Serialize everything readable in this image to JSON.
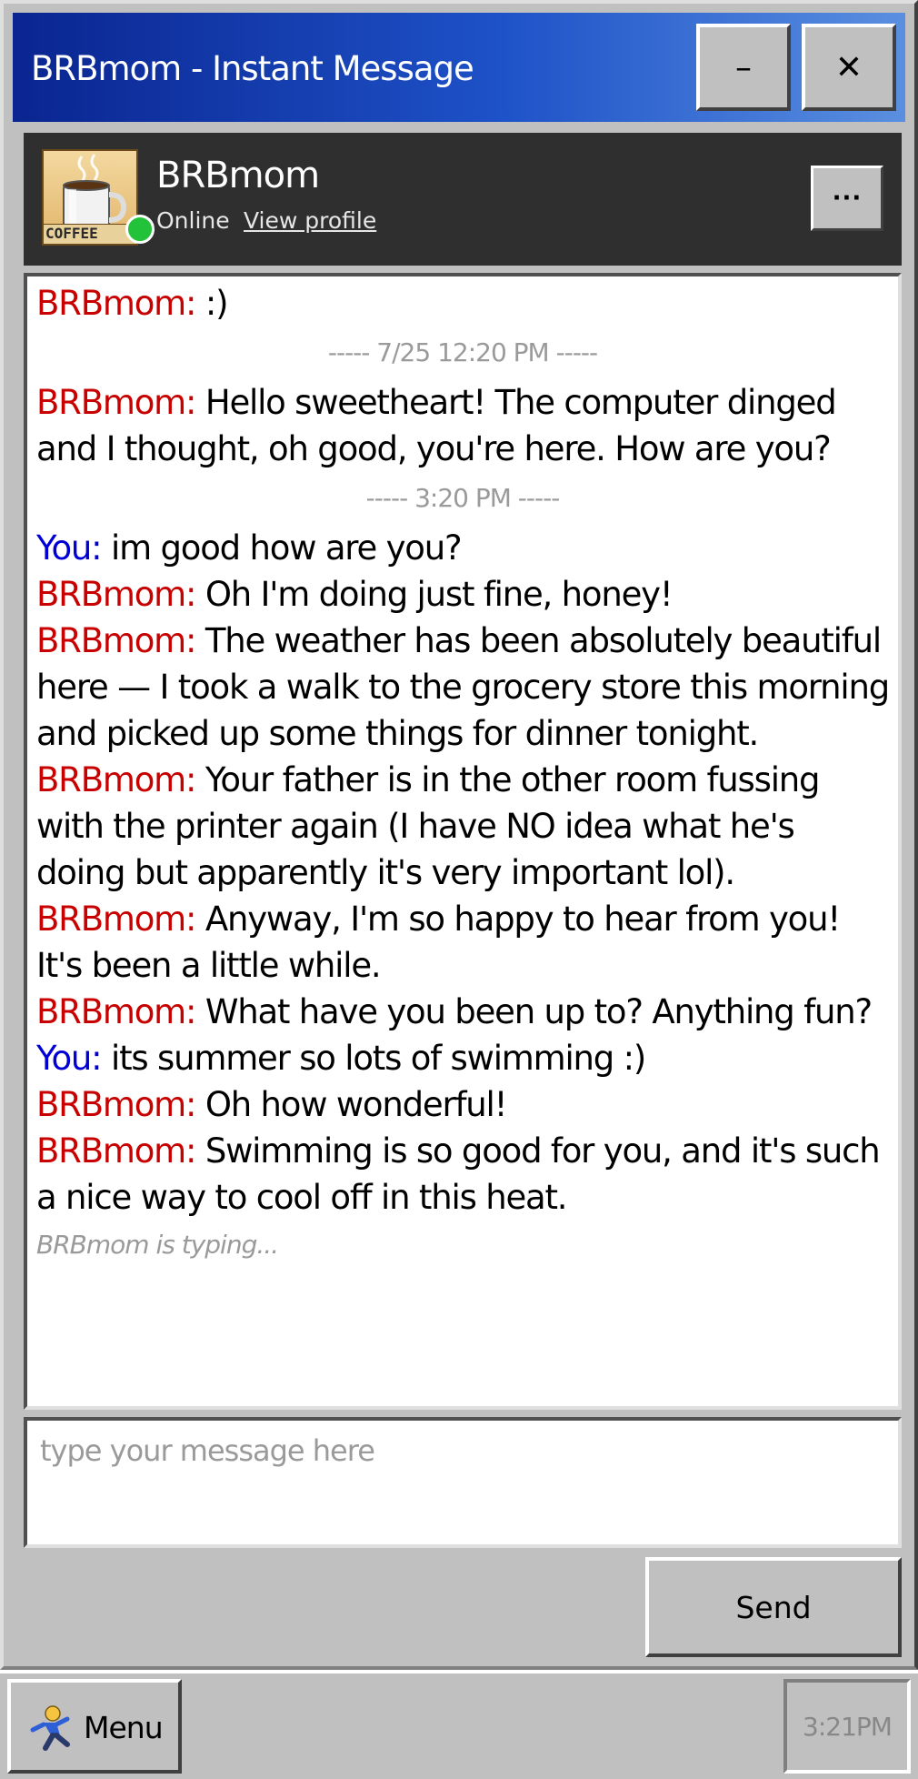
{
  "window": {
    "title": "BRBmom - Instant Message",
    "minimize_label": "–",
    "close_label": "✕"
  },
  "header": {
    "buddy_name": "BRBmom",
    "status": "Online",
    "view_profile": "View profile",
    "more_label": "···",
    "avatar_caption": "COFFEE"
  },
  "chat": {
    "messages": [
      {
        "type": "msg",
        "who": "mom",
        "sender": "BRBmom:",
        "text": " :)"
      },
      {
        "type": "stamp",
        "text": "----- 7/25 12:20 PM -----"
      },
      {
        "type": "msg",
        "who": "mom",
        "sender": "BRBmom:",
        "text": " Hello sweetheart! The computer dinged and I thought, oh good, you're here. How are you?"
      },
      {
        "type": "stamp",
        "text": "----- 3:20 PM -----"
      },
      {
        "type": "msg",
        "who": "you",
        "sender": "You:",
        "text": " im good how are you?"
      },
      {
        "type": "msg",
        "who": "mom",
        "sender": "BRBmom:",
        "text": " Oh I'm doing just fine, honey!"
      },
      {
        "type": "msg",
        "who": "mom",
        "sender": "BRBmom:",
        "text": " The weather has been absolutely beautiful here — I took a walk to the grocery store this morning and picked up some things for dinner tonight."
      },
      {
        "type": "msg",
        "who": "mom",
        "sender": "BRBmom:",
        "text": " Your father is in the other room fussing with the printer again (I have NO idea what he's doing but apparently it's very important lol)."
      },
      {
        "type": "msg",
        "who": "mom",
        "sender": "BRBmom:",
        "text": " Anyway, I'm so happy to hear from you! It's been a little while."
      },
      {
        "type": "msg",
        "who": "mom",
        "sender": "BRBmom:",
        "text": " What have you been up to? Anything fun?"
      },
      {
        "type": "msg",
        "who": "you",
        "sender": "You:",
        "text": " its summer so lots of swimming :)"
      },
      {
        "type": "msg",
        "who": "mom",
        "sender": "BRBmom:",
        "text": " Oh how wonderful!"
      },
      {
        "type": "msg",
        "who": "mom",
        "sender": "BRBmom:",
        "text": " Swimming is so good for you, and it's such a nice way to cool off in this heat."
      }
    ],
    "typing": "BRBmom is typing..."
  },
  "compose": {
    "placeholder": "type your message here",
    "value": "",
    "send_label": "Send"
  },
  "taskbar": {
    "menu_label": "Menu",
    "clock": "3:21PM"
  },
  "colors": {
    "mom": "#c80000",
    "you": "#0000d6",
    "online": "#22c33a",
    "titlebar_start": "#0a2590",
    "titlebar_end": "#5a8fe0"
  }
}
